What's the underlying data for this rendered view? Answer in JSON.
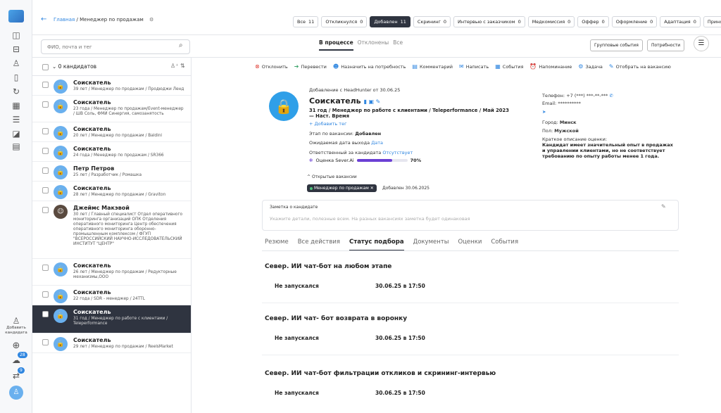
{
  "breadcrumb": {
    "home": "Главная",
    "separator": " / ",
    "current": "Менеджер по продажам"
  },
  "stages": [
    {
      "label": "Все",
      "count": "11",
      "active": false
    },
    {
      "label": "Откликнулся",
      "count": "0",
      "active": false
    },
    {
      "label": "Добавлен",
      "count": "11",
      "active": true
    },
    {
      "label": "Скрининг",
      "count": "0",
      "active": false
    },
    {
      "label": "Интервью с заказчиком",
      "count": "0",
      "active": false
    },
    {
      "label": "Медкомиссия",
      "count": "0",
      "active": false
    },
    {
      "label": "Оффер",
      "count": "0",
      "active": false
    },
    {
      "label": "Оформление",
      "count": "0",
      "active": false
    },
    {
      "label": "Адаптация",
      "count": "0",
      "active": false
    },
    {
      "label": "Принят",
      "count": "0",
      "active": false
    }
  ],
  "search": {
    "placeholder": "ФИО, почта и тег"
  },
  "view_tabs": [
    "В процессе",
    "Отклонены",
    "Все"
  ],
  "buttons": {
    "group_events": "Групповые события",
    "needs": "Потребности"
  },
  "list_header": {
    "title": "0 кандидатов"
  },
  "candidates": [
    {
      "name": "Соискатель",
      "sub": "39 лет / Менеджер по продажам / Продюджи Ленд",
      "photo": false,
      "selected": false
    },
    {
      "name": "Соискатель",
      "sub": "23 года / Менеджер по продажам/Event-менеджер / ШВ Соль, ФМИ Синергия, самозанятость",
      "photo": false,
      "selected": false
    },
    {
      "name": "Соискатель",
      "sub": "20 лет / Менеджер по продажам / Baldini",
      "photo": false,
      "selected": false
    },
    {
      "name": "Соискатель",
      "sub": "24 года / Менеджер по продажам / SR366",
      "photo": false,
      "selected": false
    },
    {
      "name": "Петр Петров",
      "sub": "25 лет / Разработчик / Ромашка",
      "photo": false,
      "selected": false
    },
    {
      "name": "Соискатель",
      "sub": "28 лет / Менеджер по продажам / Graviton",
      "photo": false,
      "selected": false
    },
    {
      "name": "Джеймс Макэвой",
      "sub": "30 лет / Главный специалист Отдел оперативного мониторинга организаций ОПК Отделения оперативного мониторинга Центр обеспечения оперативного мониторинга оборонно-промышленным комплексом / ФГУП \"ВСЕРОССИЙСКИЙ НАУЧНО-ИССЛЕДОВАТЕЛЬСКИЙ ИНСТИТУТ \"ЦЕНТР\"",
      "photo": true,
      "selected": false
    },
    {
      "name": "Соискатель",
      "sub": "26 лет / Менеджер по продажам / Редукторные механизмы,ООО",
      "photo": false,
      "selected": false
    },
    {
      "name": "Соискатель",
      "sub": "22 года / SDR - менеджер / 24TTL",
      "photo": false,
      "selected": false
    },
    {
      "name": "Соискатель",
      "sub": "31 год / Менеджер по работе с клиентами / Teleperformance",
      "photo": false,
      "selected": true
    },
    {
      "name": "Соискатель",
      "sub": "29 лет / Менеджер по продажам / ReelsMarket",
      "photo": false,
      "selected": false
    }
  ],
  "actions": [
    {
      "label": "Отклонить",
      "icon": "reject-icon",
      "glyph": "⊗",
      "tone": "red"
    },
    {
      "label": "Перевести",
      "icon": "transfer-icon",
      "glyph": "➔",
      "tone": "green"
    },
    {
      "label": "Назначить на потребность",
      "icon": "assign-icon",
      "glyph": "☻",
      "tone": "blue"
    },
    {
      "label": "Комментарий",
      "icon": "comment-icon",
      "glyph": "▤",
      "tone": "blue"
    },
    {
      "label": "Написать",
      "icon": "mail-icon",
      "glyph": "✉",
      "tone": "blue"
    },
    {
      "label": "События",
      "icon": "calendar-icon",
      "glyph": "▦",
      "tone": "blue"
    },
    {
      "label": "Напоминание",
      "icon": "reminder-icon",
      "glyph": "⏰",
      "tone": "blue"
    },
    {
      "label": "Задача",
      "icon": "task-icon",
      "glyph": "⚙",
      "tone": "blue"
    },
    {
      "label": "Отобрать на вакансию",
      "icon": "select-icon",
      "glyph": "✎",
      "tone": "blue"
    }
  ],
  "profile": {
    "source": "Добавление с HeadHunter от 30.06.25",
    "name": "Соискатель",
    "position": "31 год / Менеджер по работе с клиентами / Teleperformance / Май 2023 — Наст. Время",
    "add_tag": "+ Добавить тег",
    "stage_label": "Этап по вакансии:",
    "stage_value": "Добавлен",
    "exit_label": "Ожидаемая дата выхода",
    "exit_value": "Дата",
    "resp_label": "Ответственный за кандидата",
    "resp_value": "Отсутствует",
    "score_label": "Оценка Sever.Ai",
    "score_value": "70%",
    "score_fraction": 0.7,
    "phone_label": "Телефон:",
    "phone_value": "+7 (***) ***-**-***",
    "email_label": "Email:",
    "email_value": "**********",
    "city_label": "Город:",
    "city_value": "Минск",
    "sex_label": "Пол:",
    "sex_value": "Мужской",
    "desc_label": "Краткое описание оценки:",
    "desc_value": "Кандидат имеет значительный опыт в продажах и управлении клиентами, но не соответствует требованию по опыту работы менее 1 года.",
    "open_vacancies": "Открытые вакансии",
    "vacancy_chip": "Менеджер по продажам",
    "vacancy_added": "Добавлен 30.06.2025"
  },
  "note": {
    "label": "Заметка о кандидате",
    "placeholder": "Укажите детали, полезные всем. На разных вакансиях заметка будет одинаковая"
  },
  "tabs": [
    "Резюме",
    "Все действия",
    "Статус подбора",
    "Документы",
    "Оценки",
    "События"
  ],
  "bot_sections": [
    {
      "title": "Север. ИИ чат-бот на любом этапе",
      "status": "Не запускался",
      "date": "30.06.25 в 17:50"
    },
    {
      "title": "Север. ИИ чат- бот возврата в воронку",
      "status": "Не запускался",
      "date": "30.06.25 в 17:50"
    },
    {
      "title": "Север. ИИ чат-бот фильтрации откликов и скрининг-интервью",
      "status": "Не запускался",
      "date": "30.06.25 в 17:50"
    }
  ],
  "rail": {
    "add_label": "Добавить кандидата",
    "badge_1": "28",
    "badge_2": "9"
  },
  "colors": {
    "accent": "#2f86e0",
    "dark": "#2f3440",
    "score": "#6b3fd4"
  }
}
